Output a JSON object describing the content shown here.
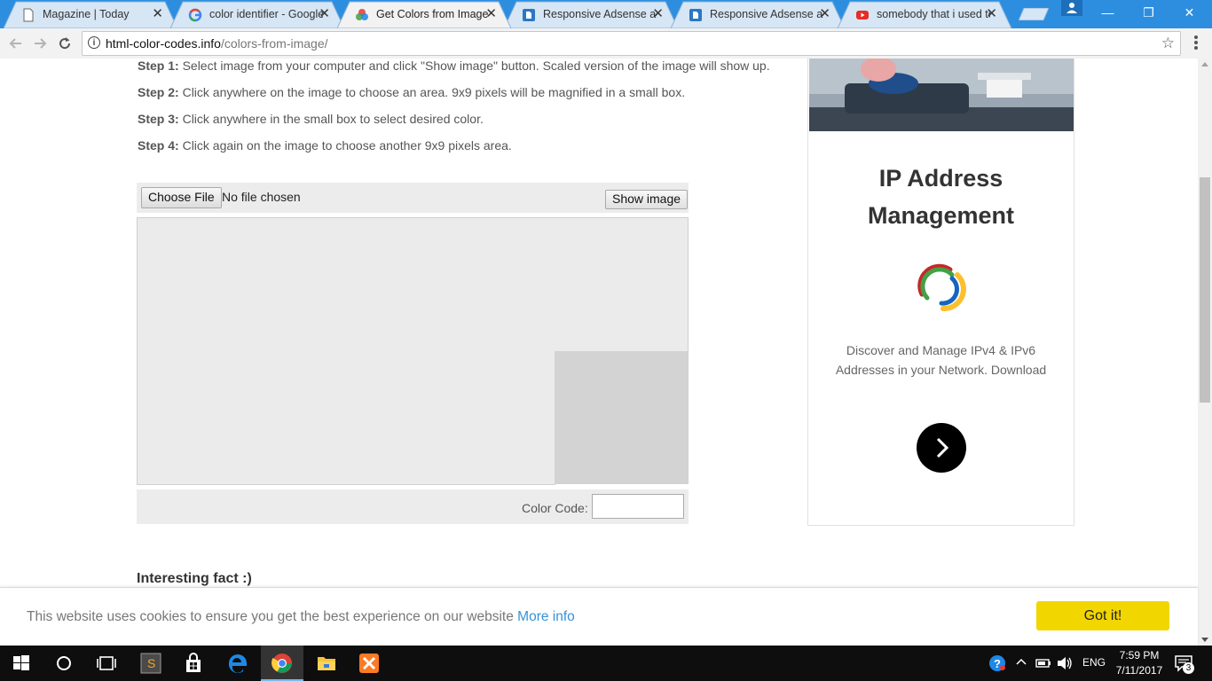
{
  "browser": {
    "tabs": [
      {
        "title": "Magazine | Today",
        "icon": "document-icon",
        "active": false
      },
      {
        "title": "color identifier - Google",
        "icon": "google-icon",
        "active": false
      },
      {
        "title": "Get Colors from Image",
        "icon": "color-wheel-icon",
        "active": true
      },
      {
        "title": "Responsive Adsense ad",
        "icon": "blogger-icon",
        "active": false
      },
      {
        "title": "Responsive Adsense ad",
        "icon": "blogger-icon",
        "active": false
      },
      {
        "title": "somebody that i used to",
        "icon": "youtube-icon",
        "active": false
      }
    ],
    "window_controls": {
      "minimize": "—",
      "restore": "❐",
      "close": "✕"
    },
    "address_host": "html-color-codes.info",
    "address_path": "/colors-from-image/"
  },
  "page": {
    "steps": [
      {
        "label": "Step 1:",
        "text": " Select image from your computer and click \"Show image\" button. Scaled version of the image will show up."
      },
      {
        "label": "Step 2:",
        "text": " Click anywhere on the image to choose an area. 9x9 pixels will be magnified in a small box."
      },
      {
        "label": "Step 3:",
        "text": " Click anywhere in the small box to select desired color."
      },
      {
        "label": "Step 4:",
        "text": " Click again on the image to choose another 9x9 pixels area."
      }
    ],
    "file_input": {
      "button": "Choose File",
      "status": "No file chosen"
    },
    "show_image_button": "Show image",
    "color_code_label": "Color Code:",
    "color_code_value": "",
    "preview_color": "#d3d3d3",
    "fact_heading": "Interesting fact :)"
  },
  "ad": {
    "title": "IP Address Management",
    "description": "Discover and Manage IPv4 & IPv6 Addresses in your Network. Download",
    "button_icon": "chevron-right-icon"
  },
  "cookie": {
    "text": "This website uses cookies to ensure you get the best experience on our website",
    "more_info": "More info",
    "button": "Got it!"
  },
  "taskbar": {
    "language": "ENG",
    "time": "7:59 PM",
    "date": "7/11/2017",
    "notification_count": "3"
  },
  "colors": {
    "tabstrip": "#2d8ee0",
    "got_it": "#f1d600",
    "link": "#3592d8"
  }
}
